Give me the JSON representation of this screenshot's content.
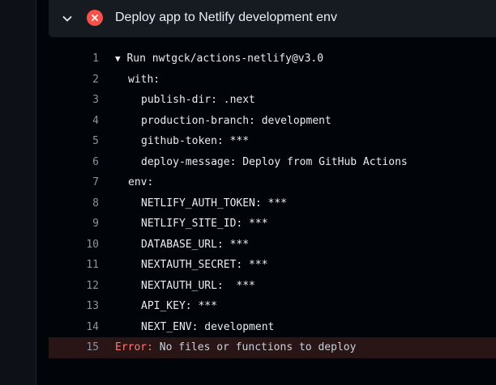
{
  "step": {
    "title": "Deploy app to Netlify development env",
    "status": "failed",
    "status_color": "#f85149"
  },
  "log": {
    "lines": [
      {
        "num": "1",
        "caret": "▼",
        "text": "Run nwtgck/actions-netlify@v3.0",
        "indent": 0
      },
      {
        "num": "2",
        "text": "with:",
        "indent": 1
      },
      {
        "num": "3",
        "text": "publish-dir: .next",
        "indent": 2
      },
      {
        "num": "4",
        "text": "production-branch: development",
        "indent": 2
      },
      {
        "num": "5",
        "text": "github-token: ***",
        "indent": 2
      },
      {
        "num": "6",
        "text": "deploy-message: Deploy from GitHub Actions",
        "indent": 2
      },
      {
        "num": "7",
        "text": "env:",
        "indent": 1
      },
      {
        "num": "8",
        "text": "NETLIFY_AUTH_TOKEN: ***",
        "indent": 2
      },
      {
        "num": "9",
        "text": "NETLIFY_SITE_ID: ***",
        "indent": 2
      },
      {
        "num": "10",
        "text": "DATABASE_URL: ***",
        "indent": 2
      },
      {
        "num": "11",
        "text": "NEXTAUTH_SECRET: ***",
        "indent": 2
      },
      {
        "num": "12",
        "text": "NEXTAUTH_URL:  ***",
        "indent": 2
      },
      {
        "num": "13",
        "text": "API_KEY: ***",
        "indent": 2
      },
      {
        "num": "14",
        "text": "NEXT_ENV: development",
        "indent": 2
      },
      {
        "num": "15",
        "text": "",
        "indent": 0
      }
    ],
    "error_line": {
      "num": "15",
      "label": "Error:",
      "message": " No files or functions to deploy"
    }
  },
  "icons": {
    "collapse": "chevron-down-icon",
    "status": "x-circle-icon"
  }
}
